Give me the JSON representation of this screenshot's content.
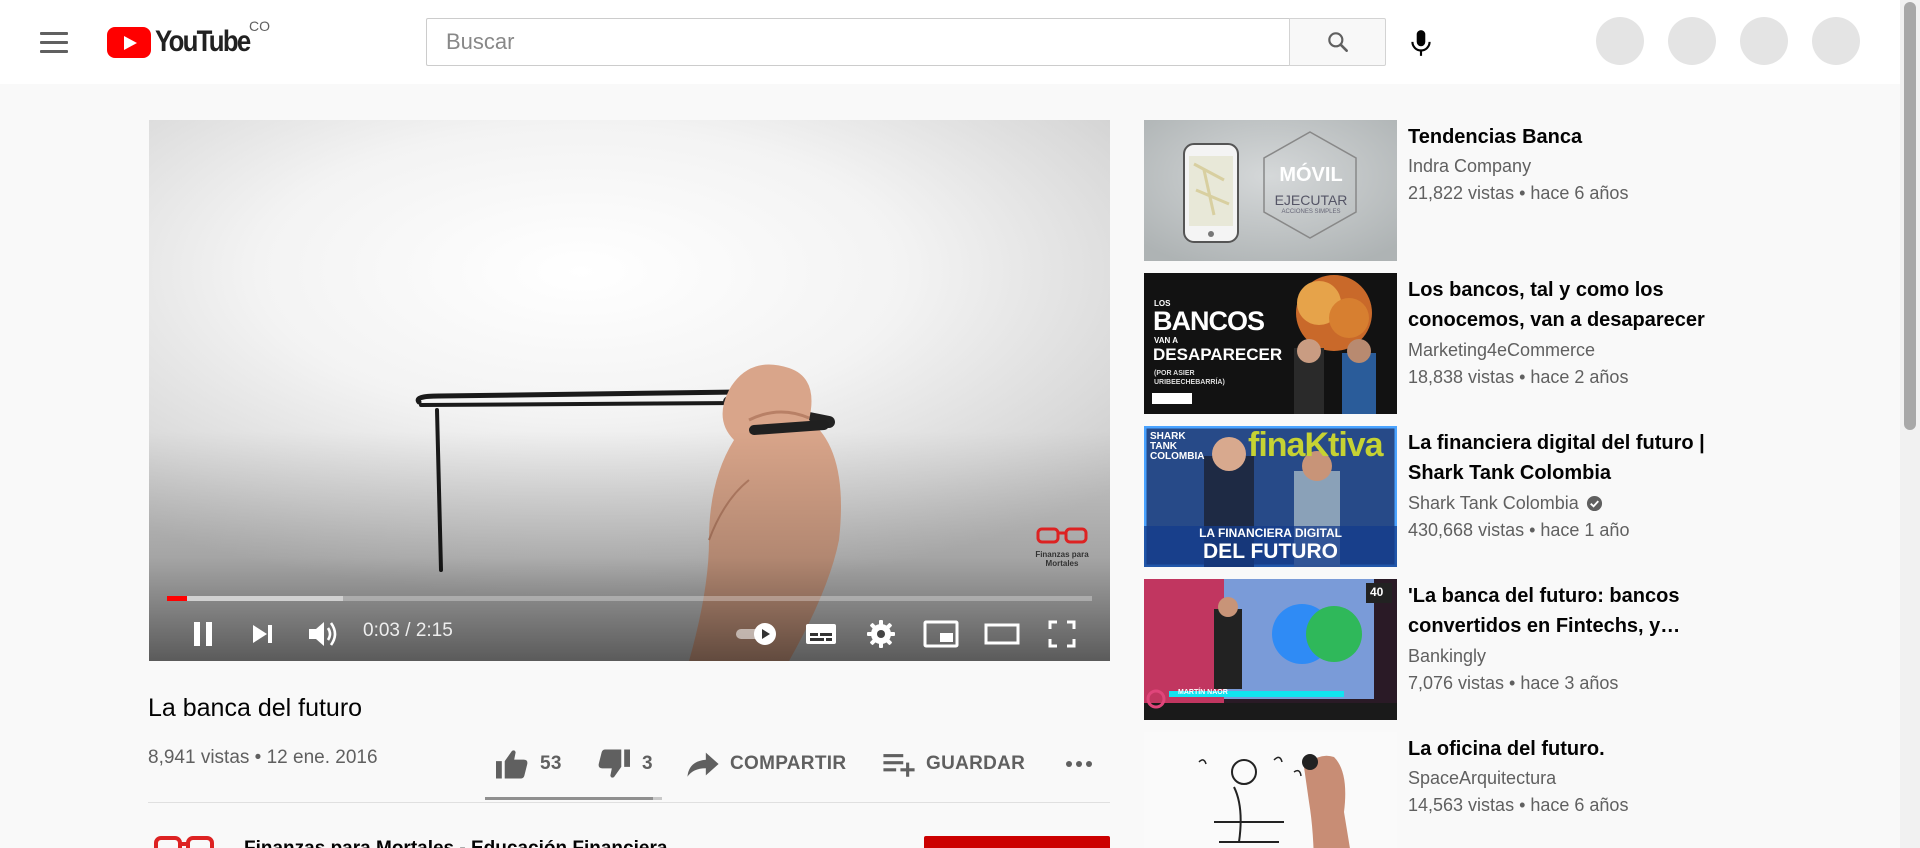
{
  "header": {
    "logo_text": "YouTube",
    "country_code": "CO",
    "search_placeholder": "Buscar"
  },
  "player": {
    "time_display": "0:03 / 2:15",
    "progress_played": 0.022,
    "progress_buffered": 0.19,
    "watermark": "Finanzas para Mortales",
    "autoplay_on": true,
    "colors": {
      "progress": "#ff0000"
    }
  },
  "video": {
    "title": "La banca del futuro",
    "meta": "8,941 vistas • 12 ene. 2016",
    "likes": "53",
    "dislikes": "3",
    "like_ratio": 0.95,
    "share_label": "COMPARTIR",
    "save_label": "GUARDAR",
    "channel_name": "Finanzas para Mortales - Educación Financiera"
  },
  "recommendations": [
    {
      "title": "Tendencias Banca",
      "channel": "Indra Company",
      "verified": false,
      "meta": "21,822 vistas • hace 6 años",
      "thumb_text_1": "MÓVIL",
      "thumb_text_2": "EJECUTAR",
      "thumb_text_3": "ACCIONES SIMPLES"
    },
    {
      "title": "Los bancos, tal y como los conocemos, van a desaparecer",
      "channel": "Marketing4eCommerce",
      "verified": false,
      "meta": "18,838 vistas • hace 2 años",
      "thumb_text_1": "LOS",
      "thumb_text_2": "BANCOS",
      "thumb_text_3": "VAN A",
      "thumb_text_4": "DESAPARECER",
      "thumb_text_5": "(POR ASIER URIBEECHEBARRÍA)"
    },
    {
      "title": "La financiera digital del futuro | Shark Tank Colombia",
      "channel": "Shark Tank Colombia",
      "verified": true,
      "meta": "430,668 vistas • hace 1 año",
      "thumb_text_1": "finaKtiva",
      "thumb_text_2": "LA FINANCIERA DIGITAL",
      "thumb_text_3": "DEL FUTURO",
      "thumb_text_4": "SHARK TANK COLOMBIA"
    },
    {
      "title": "'La banca del futuro: bancos convertidos en Fintechs, y…",
      "channel": "Bankingly",
      "verified": false,
      "meta": "7,076 vistas • hace 3 años",
      "thumb_text_1": "MARTÍN NAOR",
      "thumb_text_2": "40"
    },
    {
      "title": "La oficina del futuro.",
      "channel": "SpaceArquitectura",
      "verified": false,
      "meta": "14,563 vistas • hace 6 años"
    }
  ]
}
